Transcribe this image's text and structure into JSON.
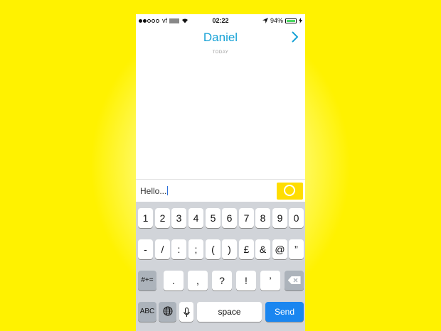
{
  "status": {
    "carrier": "vf",
    "time": "02:22",
    "battery": "94%"
  },
  "nav": {
    "title": "Daniel",
    "next_icon": "chevron-right-icon"
  },
  "chat": {
    "date_label": "TODAY"
  },
  "composer": {
    "text": "Hello...",
    "capture_icon": "snap-circle-icon"
  },
  "keyboard": {
    "row1": [
      "1",
      "2",
      "3",
      "4",
      "5",
      "6",
      "7",
      "8",
      "9",
      "0"
    ],
    "row2": [
      "-",
      "/",
      ":",
      ";",
      "(",
      ")",
      "£",
      "&",
      "@",
      "”"
    ],
    "row3_mode": "#+=",
    "row3": [
      ".",
      ",",
      "?",
      "!",
      "’"
    ],
    "abc": "ABC",
    "space": "space",
    "send": "Send"
  },
  "colors": {
    "accent": "#17a2d6",
    "snap_yellow": "#ffdd00",
    "send_blue": "#1a86f0",
    "background": "#fff200"
  }
}
